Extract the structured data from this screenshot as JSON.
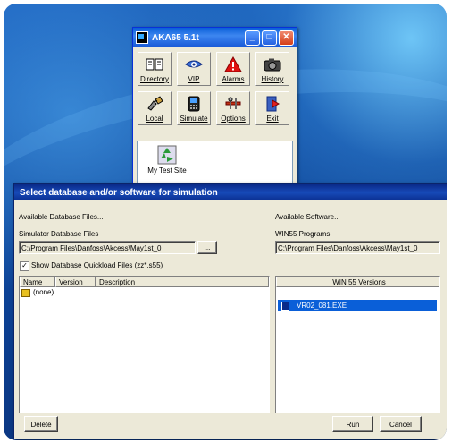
{
  "aka_window": {
    "title": "AKA65 5.1t",
    "minimize": "_",
    "maximize": "□",
    "close": "✕",
    "tools": [
      {
        "label": "Directory",
        "icon": "book-icon"
      },
      {
        "label": "VIP",
        "icon": "eye-icon"
      },
      {
        "label": "Alarms",
        "icon": "warning-icon"
      },
      {
        "label": "History",
        "icon": "camera-icon"
      },
      {
        "label": "Local",
        "icon": "local-plug-icon"
      },
      {
        "label": "Simulate",
        "icon": "phone-icon"
      },
      {
        "label": "Options",
        "icon": "tools-icon"
      },
      {
        "label": "Exit",
        "icon": "exit-door-icon"
      }
    ],
    "site": {
      "label": "My Test Site",
      "icon": "recycle-site-icon"
    }
  },
  "dialog": {
    "title": "Select database and/or software for simulation",
    "available_db_label": "Available Database Files...",
    "sim_db_label": "Simulator Database Files",
    "db_path": "C:\\Program Files\\Danfoss\\Akcess\\May1st_0",
    "browse_label": "...",
    "quickload_label": "Show Database Quickload Files (zz*.s55)",
    "quickload_checked": "✓",
    "columns": [
      "Name",
      "Version",
      "Description"
    ],
    "db_rows": [
      {
        "name": "(none)"
      }
    ],
    "available_sw_label": "Available Software...",
    "win55_programs_label": "WIN55 Programs",
    "sw_path": "C:\\Program Files\\Danfoss\\Akcess\\May1st_0",
    "versions_header": "WIN 55 Versions",
    "selected_version": "VR02_081.EXE",
    "delete_label": "Delete",
    "run_label": "Run",
    "cancel_label": "Cancel"
  }
}
